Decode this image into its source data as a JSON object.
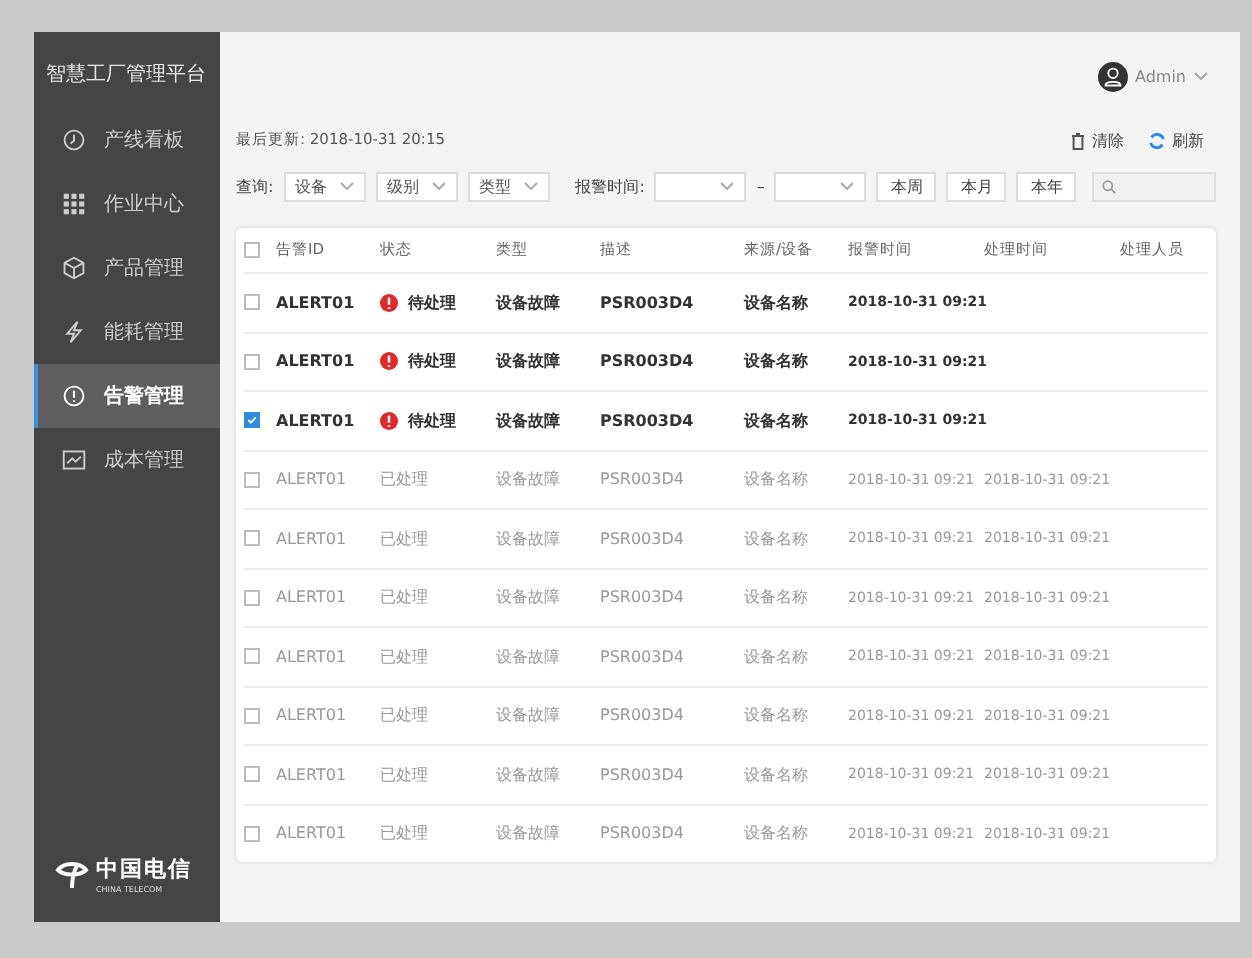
{
  "sidebar": {
    "title": "智慧工厂管理平台",
    "items": [
      {
        "label": "产线看板",
        "selected": false
      },
      {
        "label": "作业中心",
        "selected": false
      },
      {
        "label": "产品管理",
        "selected": false
      },
      {
        "label": "能耗管理",
        "selected": false
      },
      {
        "label": "告警管理",
        "selected": true
      },
      {
        "label": "成本管理",
        "selected": false
      }
    ],
    "logo": {
      "name": "中国电信",
      "subtitle": "CHINA TELECOM"
    }
  },
  "user": {
    "name": "Admin"
  },
  "last_update": "最后更新: 2018-10-31 20:15",
  "actions": [
    {
      "label": "清除",
      "kind": "clear"
    },
    {
      "label": "刷新",
      "kind": "refresh"
    }
  ],
  "filters": {
    "query_label": "查询:",
    "dropdowns": [
      "设备",
      "级别",
      "类型"
    ],
    "time_label": "报警时间:",
    "range_separator": "–",
    "quick_buttons": [
      "本周",
      "本月",
      "本年"
    ]
  },
  "table": {
    "select_all_checked": false,
    "columns": [
      "告警ID",
      "状态",
      "类型",
      "描述",
      "来源/设备",
      "报警时间",
      "处理时间",
      "处理人员"
    ],
    "rows": [
      {
        "checked": false,
        "id": "ALERT01",
        "status": "待处理",
        "pending": true,
        "type": "设备故障",
        "desc": "PSR003D4",
        "source": "设备名称",
        "alarm_time": "2018-10-31 09:21"
      },
      {
        "checked": false,
        "id": "ALERT01",
        "status": "待处理",
        "pending": true,
        "type": "设备故障",
        "desc": "PSR003D4",
        "source": "设备名称",
        "alarm_time": "2018-10-31 09:21"
      },
      {
        "checked": true,
        "id": "ALERT01",
        "status": "待处理",
        "pending": true,
        "type": "设备故障",
        "desc": "PSR003D4",
        "source": "设备名称",
        "alarm_time": "2018-10-31 09:21"
      },
      {
        "checked": false,
        "id": "ALERT01",
        "status": "已处理",
        "pending": false,
        "type": "设备故障",
        "desc": "PSR003D4",
        "source": "设备名称",
        "alarm_time": "2018-10-31 09:21",
        "handle_time": "2018-10-31 09:21"
      },
      {
        "checked": false,
        "id": "ALERT01",
        "status": "已处理",
        "pending": false,
        "type": "设备故障",
        "desc": "PSR003D4",
        "source": "设备名称",
        "alarm_time": "2018-10-31 09:21",
        "handle_time": "2018-10-31 09:21"
      },
      {
        "checked": false,
        "id": "ALERT01",
        "status": "已处理",
        "pending": false,
        "type": "设备故障",
        "desc": "PSR003D4",
        "source": "设备名称",
        "alarm_time": "2018-10-31 09:21",
        "handle_time": "2018-10-31 09:21"
      },
      {
        "checked": false,
        "id": "ALERT01",
        "status": "已处理",
        "pending": false,
        "type": "设备故障",
        "desc": "PSR003D4",
        "source": "设备名称",
        "alarm_time": "2018-10-31 09:21",
        "handle_time": "2018-10-31 09:21"
      },
      {
        "checked": false,
        "id": "ALERT01",
        "status": "已处理",
        "pending": false,
        "type": "设备故障",
        "desc": "PSR003D4",
        "source": "设备名称",
        "alarm_time": "2018-10-31 09:21",
        "handle_time": "2018-10-31 09:21"
      },
      {
        "checked": false,
        "id": "ALERT01",
        "status": "已处理",
        "pending": false,
        "type": "设备故障",
        "desc": "PSR003D4",
        "source": "设备名称",
        "alarm_time": "2018-10-31 09:21",
        "handle_time": "2018-10-31 09:21"
      },
      {
        "checked": false,
        "id": "ALERT01",
        "status": "已处理",
        "pending": false,
        "type": "设备故障",
        "desc": "PSR003D4",
        "source": "设备名称",
        "alarm_time": "2018-10-31 09:21",
        "handle_time": "2018-10-31 09:21"
      }
    ]
  }
}
